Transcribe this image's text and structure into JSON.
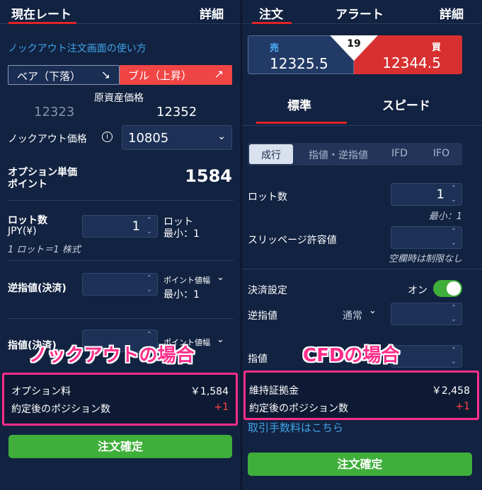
{
  "left": {
    "tabs": [
      "現在レート",
      "詳細"
    ],
    "howto_link": "ノックアウト注文画面の使い方",
    "bear_button": "ベア（下落）",
    "bull_button": "ブル（上昇）",
    "underlying_label": "原資産価格",
    "underlying_bid": "12323",
    "underlying_ask": "12352",
    "knockout_label": "ノックアウト価格",
    "knockout_value": "10805",
    "option_price_label": "オプション単価",
    "option_price_unit": "ポイント",
    "option_price_value": "1584",
    "lot_label": "ロット数",
    "lot_currency": "JPY(¥)",
    "lot_note": "1 ロット＝1 株式",
    "lot_value": "1",
    "lot_unit": "ロット",
    "lot_min": "最小：1",
    "stop_label": "逆指値(決済)",
    "stop_mode": "ポイント値幅",
    "stop_min": "最小：1",
    "limit_label": "指値(決済)",
    "limit_mode": "ポイント値幅",
    "overlay_tag": "ノックアウトの場合",
    "summary_fee_label": "オプション料",
    "summary_fee_value": "￥1,584",
    "summary_pos_label": "約定後のポジション数",
    "summary_pos_value": "+1",
    "order_button": "注文確定"
  },
  "right": {
    "tabs": [
      "注文",
      "アラート",
      "詳細"
    ],
    "sell_label": "売",
    "sell_price": "12325.5",
    "spread": "19",
    "buy_label": "買",
    "buy_price": "12344.5",
    "mode_tabs": [
      "標準",
      "スピード"
    ],
    "order_types": [
      "成行",
      "指値・逆指値",
      "IFD",
      "IFO"
    ],
    "lot_label": "ロット数",
    "lot_value": "1",
    "lot_min": "最小：1",
    "slip_label": "スリッページ許容値",
    "slip_note": "空欄時は制限なし",
    "settle_label": "決済設定",
    "settle_state": "オン",
    "stop_label": "逆指値",
    "stop_mode": "通常",
    "limit_label": "指値",
    "overlay_tag": "CFDの場合",
    "summary_margin_label": "維持証拠金",
    "summary_margin_value": "￥2,458",
    "summary_pos_label": "約定後のポジション数",
    "summary_pos_value": "+1",
    "fee_link": "取引手数料はこちら",
    "order_button": "注文確定"
  },
  "colors": {
    "accent_red": "#e02424",
    "green": "#3fae3a",
    "pink": "#ff2e8a",
    "link": "#3fa3e6"
  }
}
